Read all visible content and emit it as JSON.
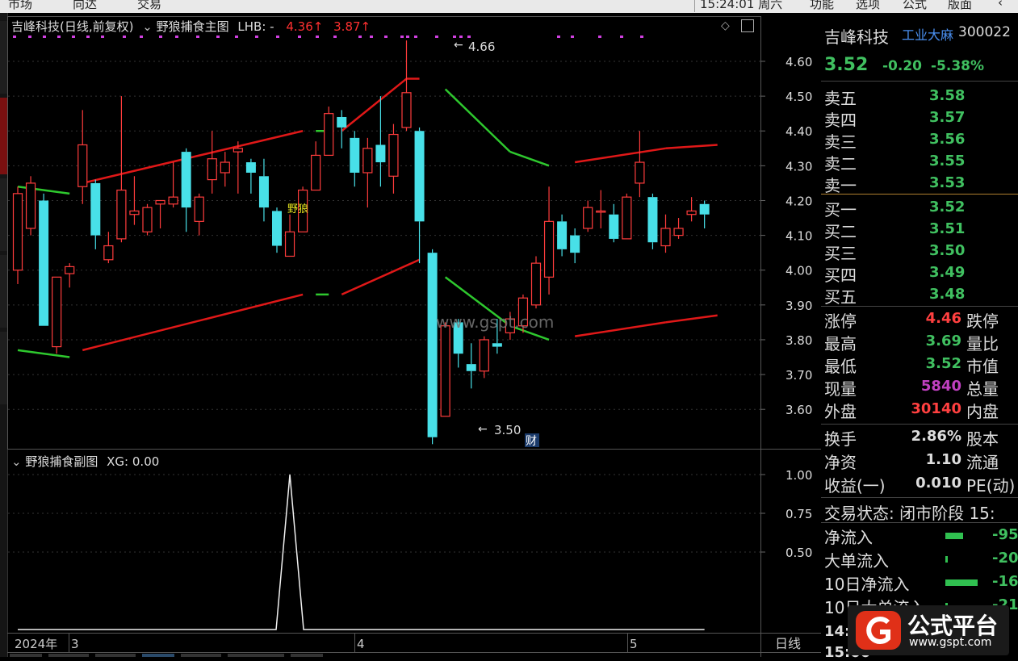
{
  "menu": {
    "items": [
      "市场",
      "向达",
      "交易"
    ],
    "time": "15:24:01 周六",
    "right": [
      "功能",
      "选项",
      "公式",
      "版面"
    ]
  },
  "chart_header": {
    "stock": "吉峰科技(日线,前复权)",
    "indicator": "野狼捕食主图",
    "lhb_label": "LHB: -",
    "val1": "4.36",
    "val2": "3.87"
  },
  "sub_header": {
    "name": "野狼捕食副图",
    "xg": "XG: 0.00"
  },
  "annotations": {
    "high": "4.66",
    "low": "3.50",
    "signal": "野狼",
    "fin": "财"
  },
  "watermark": "www.gspt.com",
  "axis": {
    "price_ticks": [
      "4.60",
      "4.50",
      "4.40",
      "4.30",
      "4.20",
      "4.10",
      "4.00",
      "3.90",
      "3.80",
      "3.70",
      "3.60"
    ],
    "sub_ticks": [
      "1.00",
      "0.75",
      "0.50"
    ],
    "year": "2024年",
    "months": [
      "3",
      "4",
      "5"
    ],
    "period": "日线"
  },
  "chart_data": {
    "type": "candlestick",
    "ylim": [
      3.5,
      4.66
    ],
    "candles": [
      {
        "o": 4.0,
        "c": 4.22,
        "h": 4.24,
        "l": 3.96
      },
      {
        "o": 4.12,
        "c": 4.25,
        "h": 4.27,
        "l": 4.1
      },
      {
        "o": 4.2,
        "c": 3.84,
        "h": 4.22,
        "l": 3.84
      },
      {
        "o": 3.78,
        "c": 3.98,
        "h": 3.98,
        "l": 3.76
      },
      {
        "o": 3.99,
        "c": 4.01,
        "h": 4.02,
        "l": 3.95
      },
      {
        "o": 4.24,
        "c": 4.36,
        "h": 4.46,
        "l": 4.19
      },
      {
        "o": 4.25,
        "c": 4.1,
        "h": 4.26,
        "l": 4.06
      },
      {
        "o": 4.03,
        "c": 4.07,
        "h": 4.11,
        "l": 4.02
      },
      {
        "o": 4.09,
        "c": 4.23,
        "h": 4.5,
        "l": 4.08
      },
      {
        "o": 4.16,
        "c": 4.17,
        "h": 4.27,
        "l": 4.13
      },
      {
        "o": 4.11,
        "c": 4.18,
        "h": 4.19,
        "l": 4.1
      },
      {
        "o": 4.19,
        "c": 4.2,
        "h": 4.2,
        "l": 4.12
      },
      {
        "o": 4.19,
        "c": 4.21,
        "h": 4.31,
        "l": 4.18
      },
      {
        "o": 4.34,
        "c": 4.18,
        "h": 4.35,
        "l": 4.11
      },
      {
        "o": 4.14,
        "c": 4.21,
        "h": 4.22,
        "l": 4.1
      },
      {
        "o": 4.26,
        "c": 4.32,
        "h": 4.4,
        "l": 4.22
      },
      {
        "o": 4.28,
        "c": 4.31,
        "h": 4.34,
        "l": 4.24
      },
      {
        "o": 4.34,
        "c": 4.35,
        "h": 4.37,
        "l": 4.22
      },
      {
        "o": 4.31,
        "c": 4.28,
        "h": 4.32,
        "l": 4.22
      },
      {
        "o": 4.27,
        "c": 4.18,
        "h": 4.32,
        "l": 4.14
      },
      {
        "o": 4.17,
        "c": 4.07,
        "h": 4.18,
        "l": 4.05
      },
      {
        "o": 4.04,
        "c": 4.11,
        "h": 4.16,
        "l": 4.04
      },
      {
        "o": 4.11,
        "c": 4.23,
        "h": 4.24,
        "l": 4.11
      },
      {
        "o": 4.23,
        "c": 4.33,
        "h": 4.37,
        "l": 4.23
      },
      {
        "o": 4.33,
        "c": 4.45,
        "h": 4.47,
        "l": 4.33
      },
      {
        "o": 4.44,
        "c": 4.41,
        "h": 4.46,
        "l": 4.35
      },
      {
        "o": 4.38,
        "c": 4.28,
        "h": 4.4,
        "l": 4.24
      },
      {
        "o": 4.28,
        "c": 4.35,
        "h": 4.38,
        "l": 4.18
      },
      {
        "o": 4.36,
        "c": 4.31,
        "h": 4.5,
        "l": 4.24
      },
      {
        "o": 4.27,
        "c": 4.39,
        "h": 4.42,
        "l": 4.22
      },
      {
        "o": 4.41,
        "c": 4.51,
        "h": 4.66,
        "l": 4.4
      },
      {
        "o": 4.4,
        "c": 4.14,
        "h": 4.41,
        "l": 4.02
      },
      {
        "o": 4.05,
        "c": 3.52,
        "h": 4.06,
        "l": 3.5
      },
      {
        "o": 3.58,
        "c": 3.84,
        "h": 3.85,
        "l": 3.58
      },
      {
        "o": 3.85,
        "c": 3.76,
        "h": 3.86,
        "l": 3.72
      },
      {
        "o": 3.73,
        "c": 3.71,
        "h": 3.79,
        "l": 3.66
      },
      {
        "o": 3.71,
        "c": 3.8,
        "h": 3.81,
        "l": 3.69
      },
      {
        "o": 3.79,
        "c": 3.78,
        "h": 3.86,
        "l": 3.76
      },
      {
        "o": 3.82,
        "c": 3.86,
        "h": 3.88,
        "l": 3.8
      },
      {
        "o": 3.84,
        "c": 3.92,
        "h": 3.93,
        "l": 3.82
      },
      {
        "o": 3.9,
        "c": 4.02,
        "h": 4.04,
        "l": 3.89
      },
      {
        "o": 3.98,
        "c": 4.14,
        "h": 4.24,
        "l": 3.93
      },
      {
        "o": 4.14,
        "c": 4.06,
        "h": 4.16,
        "l": 4.04
      },
      {
        "o": 4.1,
        "c": 4.05,
        "h": 4.12,
        "l": 4.02
      },
      {
        "o": 4.12,
        "c": 4.18,
        "h": 4.2,
        "l": 4.11
      },
      {
        "o": 4.17,
        "c": 4.17,
        "h": 4.23,
        "l": 4.12
      },
      {
        "o": 4.16,
        "c": 4.09,
        "h": 4.19,
        "l": 4.08
      },
      {
        "o": 4.09,
        "c": 4.21,
        "h": 4.22,
        "l": 4.09
      },
      {
        "o": 4.25,
        "c": 4.31,
        "h": 4.4,
        "l": 4.21
      },
      {
        "o": 4.21,
        "c": 4.08,
        "h": 4.22,
        "l": 4.06
      },
      {
        "o": 4.07,
        "c": 4.12,
        "h": 4.16,
        "l": 4.05
      },
      {
        "o": 4.1,
        "c": 4.12,
        "h": 4.15,
        "l": 4.09
      },
      {
        "o": 4.16,
        "c": 4.17,
        "h": 4.21,
        "l": 4.14
      },
      {
        "o": 4.19,
        "c": 4.16,
        "h": 4.2,
        "l": 4.12
      }
    ],
    "upper_band": [
      {
        "i": 0,
        "v": 4.24,
        "c": "g"
      },
      {
        "i": 4,
        "v": 4.22,
        "c": "g"
      },
      {
        "i": 5,
        "v": 4.25,
        "c": "r"
      },
      {
        "i": 22,
        "v": 4.4,
        "c": "r"
      },
      {
        "i": 23,
        "v": 4.4,
        "c": "g"
      },
      {
        "i": 24,
        "v": 4.4,
        "c": "g"
      },
      {
        "i": 25,
        "v": 4.4,
        "c": "r"
      },
      {
        "i": 30,
        "v": 4.55,
        "c": "r"
      },
      {
        "i": 31,
        "v": 4.55,
        "c": "r"
      },
      {
        "i": 33,
        "v": 4.52,
        "c": "g"
      },
      {
        "i": 38,
        "v": 4.34,
        "c": "g"
      },
      {
        "i": 41,
        "v": 4.3,
        "c": "g"
      },
      {
        "i": 43,
        "v": 4.31,
        "c": "r"
      },
      {
        "i": 50,
        "v": 4.35,
        "c": "r"
      },
      {
        "i": 54,
        "v": 4.36,
        "c": "r"
      }
    ],
    "lower_band": [
      {
        "i": 0,
        "v": 3.77,
        "c": "g"
      },
      {
        "i": 4,
        "v": 3.75,
        "c": "g"
      },
      {
        "i": 5,
        "v": 3.77,
        "c": "r"
      },
      {
        "i": 22,
        "v": 3.93,
        "c": "r"
      },
      {
        "i": 23,
        "v": 3.93,
        "c": "g"
      },
      {
        "i": 24,
        "v": 3.93,
        "c": "g"
      },
      {
        "i": 25,
        "v": 3.93,
        "c": "r"
      },
      {
        "i": 31,
        "v": 4.03,
        "c": "r"
      },
      {
        "i": 33,
        "v": 3.98,
        "c": "g"
      },
      {
        "i": 38,
        "v": 3.84,
        "c": "g"
      },
      {
        "i": 41,
        "v": 3.8,
        "c": "g"
      },
      {
        "i": 43,
        "v": 3.81,
        "c": "r"
      },
      {
        "i": 50,
        "v": 3.85,
        "c": "r"
      },
      {
        "i": 54,
        "v": 3.87,
        "c": "r"
      }
    ],
    "xg": {
      "peak_index": 21,
      "value": 1.0,
      "ylim": [
        0,
        1.0
      ]
    }
  },
  "quote": {
    "name": "吉峰科技",
    "board": "工业大麻",
    "code": "300022",
    "price": "3.52",
    "change": "-0.20",
    "pct": "-5.38%",
    "asks": [
      {
        "label": "卖五",
        "price": "3.58"
      },
      {
        "label": "卖四",
        "price": "3.57"
      },
      {
        "label": "卖三",
        "price": "3.56"
      },
      {
        "label": "卖二",
        "price": "3.55"
      },
      {
        "label": "卖一",
        "price": "3.53"
      }
    ],
    "bids": [
      {
        "label": "买一",
        "price": "3.52"
      },
      {
        "label": "买二",
        "price": "3.51"
      },
      {
        "label": "买三",
        "price": "3.50"
      },
      {
        "label": "买四",
        "price": "3.49"
      },
      {
        "label": "买五",
        "price": "3.48"
      }
    ],
    "stats": [
      {
        "l1": "涨停",
        "v": "4.46",
        "l2": "跌停",
        "color": "#ff4040"
      },
      {
        "l1": "最高",
        "v": "3.69",
        "l2": "量比",
        "color": "#40c060"
      },
      {
        "l1": "最低",
        "v": "3.52",
        "l2": "市值",
        "color": "#40c060"
      },
      {
        "l1": "现量",
        "v": "5840",
        "l2": "总量",
        "color": "#c040c0"
      },
      {
        "l1": "外盘",
        "v": "30140",
        "l2": "内盘",
        "color": "#ff4040"
      }
    ],
    "stats2": [
      {
        "l1": "换手",
        "v": "2.86%",
        "l2": "股本"
      },
      {
        "l1": "净资",
        "v": "1.10",
        "l2": "流通"
      },
      {
        "l1": "收益(一)",
        "v": "0.010",
        "l2": "PE(动)"
      }
    ],
    "status": "交易状态: 闭市阶段 15:",
    "flows": [
      {
        "label": "净流入",
        "val": "-95",
        "bar": 22
      },
      {
        "label": "大单流入",
        "val": "-20",
        "bar": 3
      },
      {
        "label": "10日净流入",
        "val": "-16",
        "bar": 40
      },
      {
        "label": "10日大单流入",
        "val": "-21",
        "bar": 3
      }
    ],
    "times": [
      "14:",
      "15:00"
    ]
  },
  "logo": {
    "text": "公式平台",
    "url": "www.gspt.com"
  }
}
